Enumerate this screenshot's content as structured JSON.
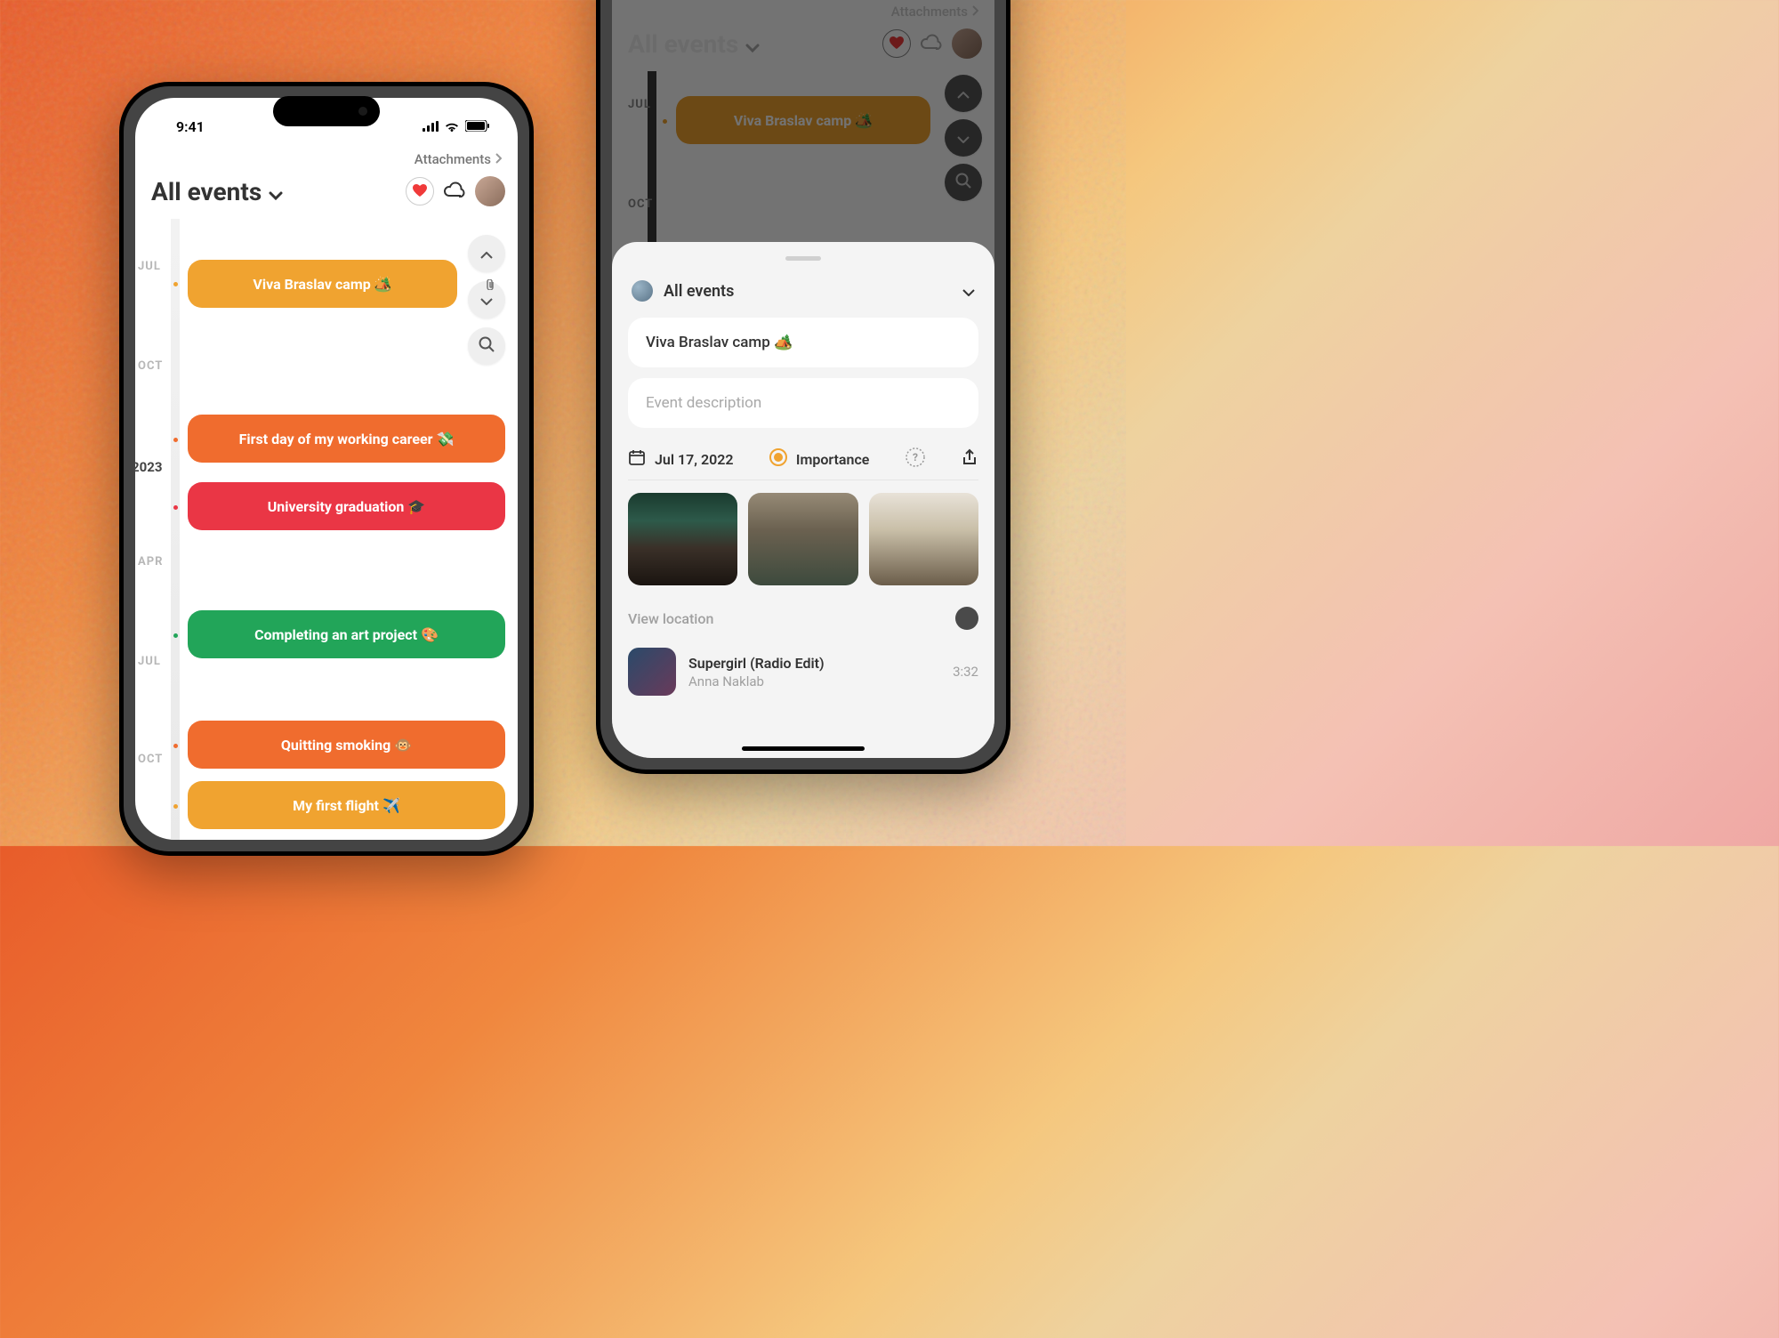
{
  "status": {
    "time": "9:41"
  },
  "header": {
    "attachments_label": "Attachments",
    "title": "All events"
  },
  "timeline": {
    "months": {
      "jul1": "JUL",
      "oct1": "OCT",
      "year": "2023",
      "apr": "APR",
      "jul2": "JUL",
      "oct2": "OCT"
    },
    "events": {
      "viva": "Viva Braslav camp 🏕️",
      "firstday": "First day of my working career 💸",
      "grad": "University graduation 🎓",
      "art": "Completing an art project 🎨",
      "quit": "Quitting smoking 🐵",
      "flight": "My first flight ✈️"
    }
  },
  "sheet": {
    "dropdown_label": "All events",
    "event_title": "Viva Braslav camp 🏕️",
    "desc_placeholder": "Event description",
    "date": "Jul 17, 2022",
    "importance_label": "Importance",
    "view_location": "View location",
    "song": {
      "title": "Supergirl (Radio Edit)",
      "artist": "Anna Naklab",
      "duration": "3:32"
    }
  },
  "colors": {
    "orange": "#f0a330",
    "deeporange": "#f06c2e",
    "red": "#ea3645",
    "green": "#22a559"
  }
}
